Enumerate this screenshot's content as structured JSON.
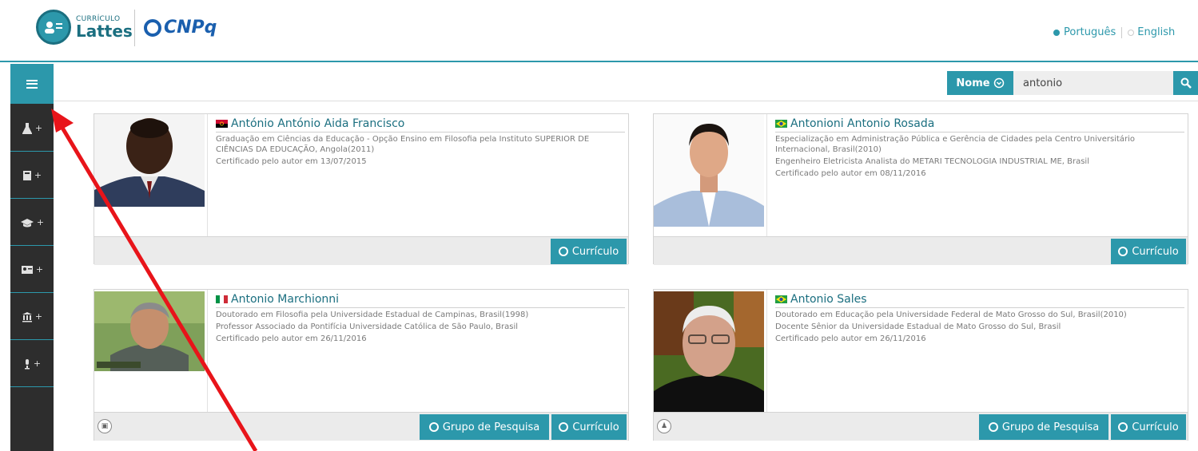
{
  "header": {
    "lattes_small": "CURRÍCULO",
    "lattes_big": "Lattes",
    "cnpq": "CNPq",
    "lang_active": "Português",
    "lang_other": "English"
  },
  "sidebar": {
    "items": [
      {
        "icon": "flask-icon",
        "glyph": "⚗"
      },
      {
        "icon": "book-icon",
        "glyph": "▤"
      },
      {
        "icon": "graduation-cap-icon",
        "glyph": "🎓"
      },
      {
        "icon": "id-card-icon",
        "glyph": "▭"
      },
      {
        "icon": "institution-icon",
        "glyph": "🏛"
      },
      {
        "icon": "microphone-icon",
        "glyph": "🎤"
      }
    ]
  },
  "search": {
    "label": "Nome",
    "value": "antonio"
  },
  "results": [
    {
      "name": "António António Aida Francisco",
      "flag": "angola",
      "lines": [
        "Graduação em Ciências da Educação - Opção Ensino em Filosofia pela Instituto SUPERIOR DE CIÊNCIAS DA EDUCAÇÃO, Angola(2011)",
        "Certificado pelo autor em 13/07/2015"
      ],
      "buttons": [
        "Currículo"
      ]
    },
    {
      "name": "Antonioni Antonio Rosada",
      "flag": "brazil",
      "lines": [
        "Especialização em Administração Pública e Gerência de Cidades pela Centro Universitário Internacional, Brasil(2010)",
        "Engenheiro Eletricista Analista do METARI TECNOLOGIA INDUSTRIAL ME, Brasil",
        "Certificado pelo autor em 08/11/2016"
      ],
      "buttons": [
        "Currículo"
      ]
    },
    {
      "name": "Antonio Marchionni",
      "flag": "italy",
      "lines": [
        "Doutorado em Filosofia pela Universidade Estadual de Campinas, Brasil(1998)",
        "Professor Associado da Pontifícia Universidade Católica de São Paulo, Brasil",
        "Certificado pelo autor em 26/11/2016"
      ],
      "buttons": [
        "Grupo de Pesquisa",
        "Currículo"
      ]
    },
    {
      "name": "Antonio Sales",
      "flag": "brazil",
      "lines": [
        "Doutorado em Educação pela Universidade Federal de Mato Grosso do Sul, Brasil(2010)",
        "Docente Sênior da Universidade Estadual de Mato Grosso do Sul, Brasil",
        "Certificado pelo autor em 26/11/2016"
      ],
      "buttons": [
        "Grupo de Pesquisa",
        "Currículo"
      ]
    }
  ],
  "colors": {
    "accent": "#2c98ab",
    "sidebar": "#2d2d2d",
    "annotation_arrow": "#e8141a"
  }
}
